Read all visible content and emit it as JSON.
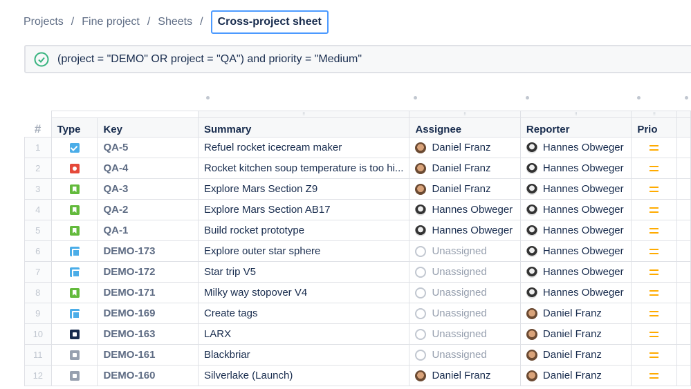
{
  "breadcrumb": [
    "Projects",
    "Fine project",
    "Sheets"
  ],
  "breadcrumb_current": "Cross-project sheet",
  "jql": "(project = \"DEMO\" OR project = \"QA\") and priority = \"Medium\"",
  "columns": {
    "hash": "#",
    "type": "Type",
    "key": "Key",
    "summary": "Summary",
    "assignee": "Assignee",
    "reporter": "Reporter",
    "prio": "Prio"
  },
  "colors": {
    "task": "#4bade8",
    "bug": "#e5493a",
    "story": "#63ba3c",
    "subtask": "#4bade8",
    "dark": "#172b4d",
    "grey": "#97a0af",
    "prio_medium": "#ffab00"
  },
  "rows": [
    {
      "n": "1",
      "type": "task",
      "key": "QA-5",
      "summary": "Refuel rocket icecream maker",
      "assignee": "Daniel Franz",
      "reporter": "Hannes Obweger",
      "prio": "medium"
    },
    {
      "n": "2",
      "type": "bug",
      "key": "QA-4",
      "summary": "Rocket kitchen soup temperature is too hi...",
      "assignee": "Daniel Franz",
      "reporter": "Hannes Obweger",
      "prio": "medium"
    },
    {
      "n": "3",
      "type": "story",
      "key": "QA-3",
      "summary": "Explore Mars Section Z9",
      "assignee": "Daniel Franz",
      "reporter": "Hannes Obweger",
      "prio": "medium"
    },
    {
      "n": "4",
      "type": "story",
      "key": "QA-2",
      "summary": "Explore Mars Section AB17",
      "assignee": "Hannes Obweger",
      "reporter": "Hannes Obweger",
      "prio": "medium"
    },
    {
      "n": "5",
      "type": "story",
      "key": "QA-1",
      "summary": "Build rocket prototype",
      "assignee": "Hannes Obweger",
      "reporter": "Hannes Obweger",
      "prio": "medium"
    },
    {
      "n": "6",
      "type": "subtask",
      "key": "DEMO-173",
      "summary": "Explore outer star sphere",
      "assignee": "Unassigned",
      "reporter": "Hannes Obweger",
      "prio": "medium"
    },
    {
      "n": "7",
      "type": "subtask",
      "key": "DEMO-172",
      "summary": "Star trip V5",
      "assignee": "Unassigned",
      "reporter": "Hannes Obweger",
      "prio": "medium"
    },
    {
      "n": "8",
      "type": "story",
      "key": "DEMO-171",
      "summary": "Milky way stopover V4",
      "assignee": "Unassigned",
      "reporter": "Hannes Obweger",
      "prio": "medium"
    },
    {
      "n": "9",
      "type": "subtask",
      "key": "DEMO-169",
      "summary": "Create tags",
      "assignee": "Unassigned",
      "reporter": "Daniel Franz",
      "prio": "medium"
    },
    {
      "n": "10",
      "type": "dark",
      "key": "DEMO-163",
      "summary": "LARX",
      "assignee": "Unassigned",
      "reporter": "Daniel Franz",
      "prio": "medium"
    },
    {
      "n": "11",
      "type": "grey",
      "key": "DEMO-161",
      "summary": "Blackbriar",
      "assignee": "Unassigned",
      "reporter": "Daniel Franz",
      "prio": "medium"
    },
    {
      "n": "12",
      "type": "grey",
      "key": "DEMO-160",
      "summary": "Silverlake (Launch)",
      "assignee": "Daniel Franz",
      "reporter": "Daniel Franz",
      "prio": "medium"
    }
  ]
}
